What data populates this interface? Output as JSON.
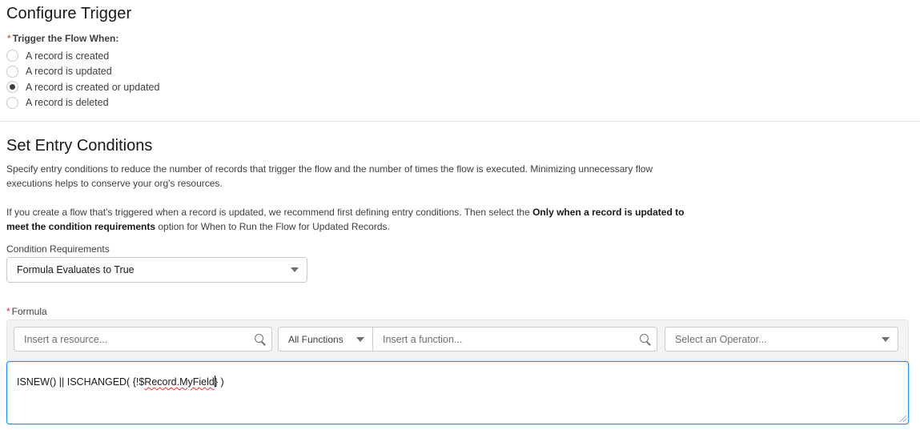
{
  "trigger": {
    "title": "Configure Trigger",
    "required_marker": "*",
    "legend": "Trigger the Flow When:",
    "options": [
      {
        "label": "A record is created",
        "checked": false
      },
      {
        "label": "A record is updated",
        "checked": false
      },
      {
        "label": "A record is created or updated",
        "checked": true
      },
      {
        "label": "A record is deleted",
        "checked": false
      }
    ]
  },
  "entry": {
    "title": "Set Entry Conditions",
    "para1": "Specify entry conditions to reduce the number of records that trigger the flow and the number of times the flow is executed. Minimizing unnecessary flow executions helps to conserve your org's resources.",
    "para2_pre": "If you create a flow that's triggered when a record is updated, we recommend first defining entry conditions. Then select the ",
    "para2_bold": "Only when a record is updated to meet the condition requirements",
    "para2_post": " option for When to Run the Flow for Updated Records.",
    "condition_label": "Condition Requirements",
    "condition_value": "Formula Evaluates to True",
    "formula_required_marker": "*",
    "formula_label": "Formula",
    "resource_placeholder": "Insert a resource...",
    "functions_select": "All Functions",
    "function_placeholder": "Insert a function...",
    "operator_placeholder": "Select an Operator...",
    "formula_pre": "ISNEW() || ISCHANGED( {!$",
    "formula_misspelled": "Record.MyField",
    "formula_post": "} )"
  }
}
